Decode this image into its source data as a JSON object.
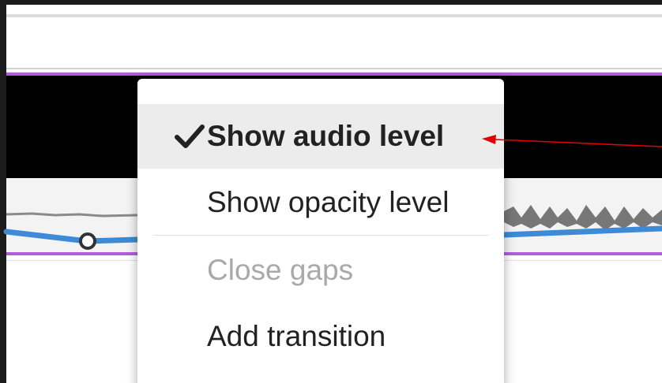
{
  "context_menu": {
    "items": [
      {
        "label": "Show audio level",
        "checked": true,
        "enabled": true
      },
      {
        "label": "Show opacity level",
        "checked": false,
        "enabled": true
      },
      {
        "label": "Close gaps",
        "checked": false,
        "enabled": false
      },
      {
        "label": "Add transition",
        "checked": false,
        "enabled": true
      }
    ]
  },
  "colors": {
    "clip_border": "#b25ce0",
    "audio_level_line": "#3d8ad6",
    "annotation_arrow": "#e00000"
  },
  "icons": {
    "checked_item": "checkmark-icon"
  }
}
